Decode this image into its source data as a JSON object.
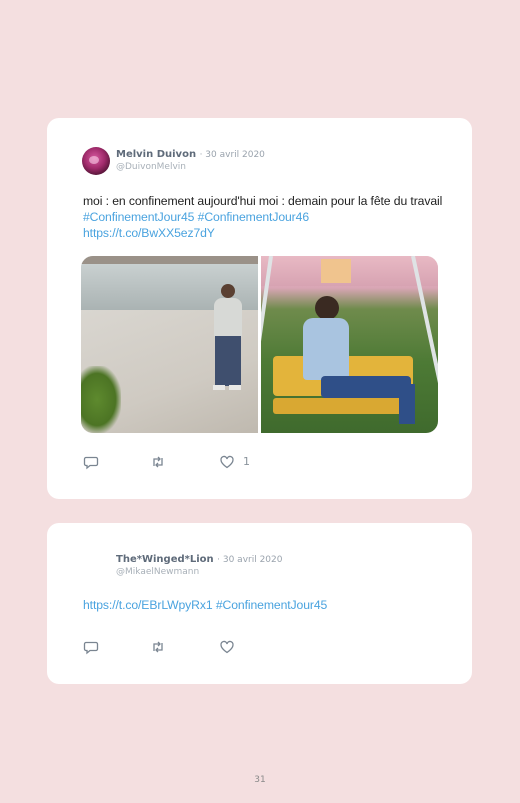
{
  "tweets": [
    {
      "author_name": "Melvin Duivon",
      "date": "· 30 avril 2020",
      "handle": "@DuivonMelvin",
      "text_plain": "moi : en confinement aujourd'hui moi : demain pour la fête du travail",
      "hashtags": [
        "#ConfinementJour45",
        "#ConfinementJour46"
      ],
      "link": "https://t.co/BwXX5ez7dY",
      "media_count": 2,
      "actions": {
        "reply_icon": "reply-icon",
        "retweet_icon": "retweet-icon",
        "like_icon": "heart-icon",
        "like_count": "1"
      }
    },
    {
      "author_name": "The*Winged*Lion",
      "date": "· 30 avril 2020",
      "handle": "@MikaelNewmann",
      "link": "https://t.co/EBrLWpyRx1",
      "hashtag": "#ConfinementJour45",
      "actions": {
        "reply_icon": "reply-icon",
        "retweet_icon": "retweet-icon",
        "like_icon": "heart-icon"
      }
    }
  ],
  "page_number": "31",
  "colors": {
    "background": "#f4dfe0",
    "card": "#ffffff",
    "link": "#4aa3df",
    "name": "#5f6b7a",
    "muted": "#9aa3ad"
  }
}
